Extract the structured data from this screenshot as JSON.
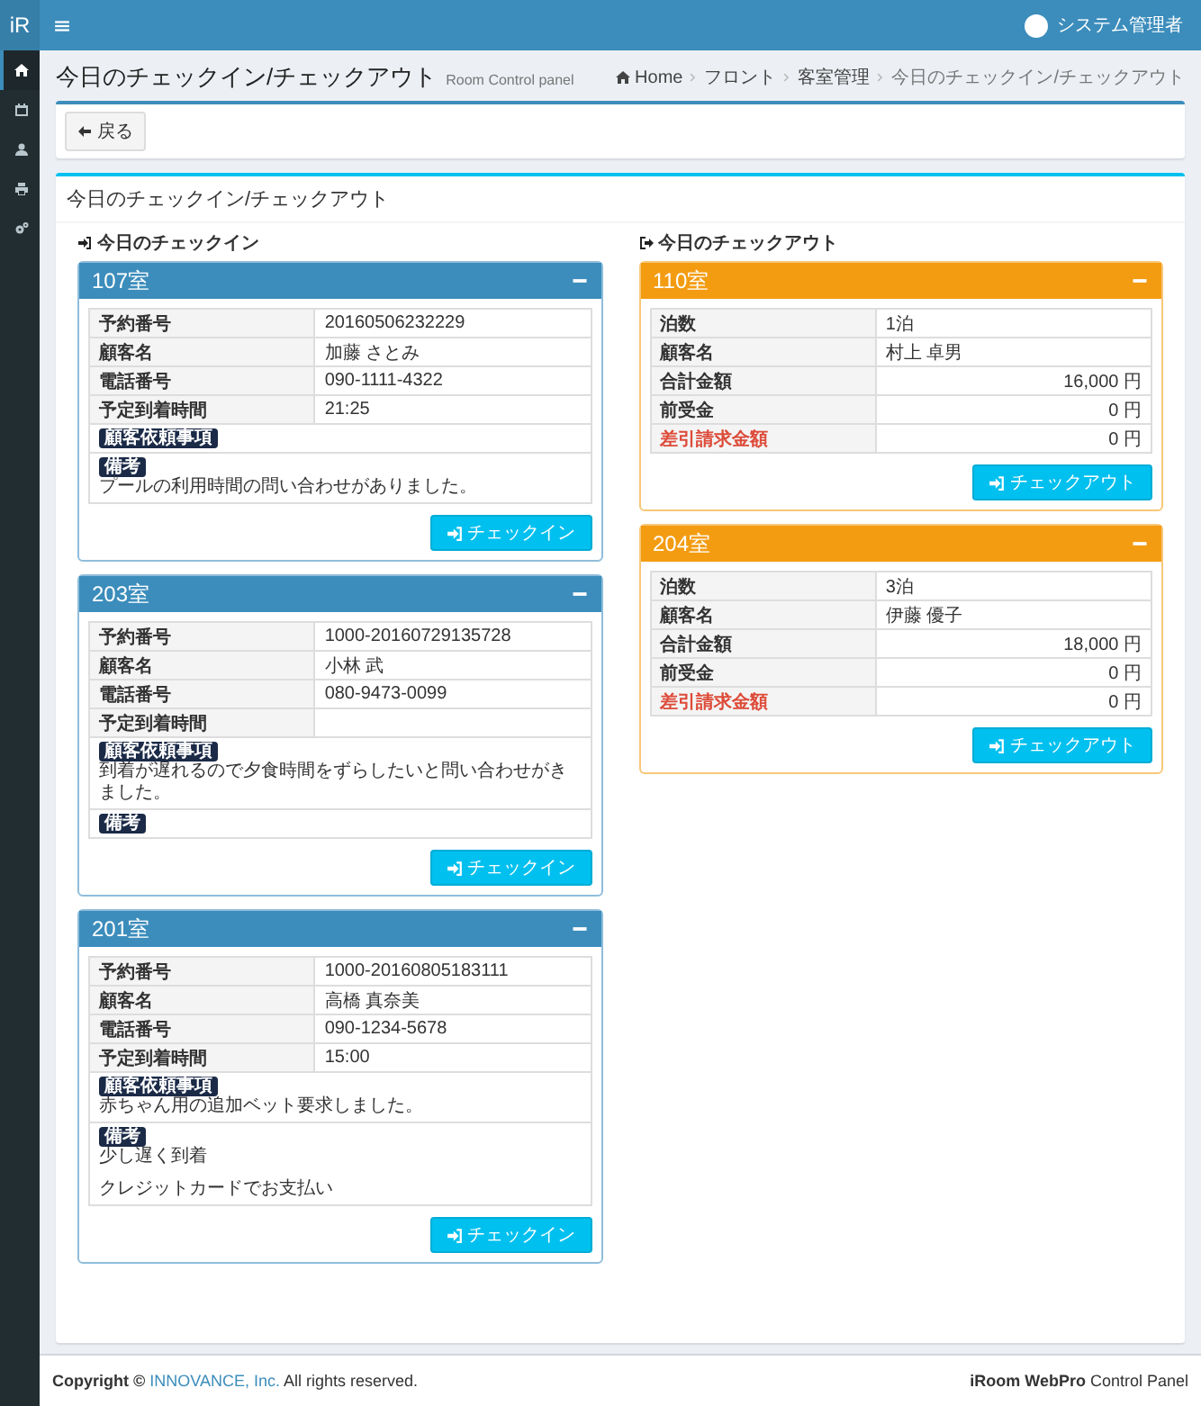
{
  "topbar": {
    "logo": "iR",
    "user": "システム管理者"
  },
  "sidebar": {
    "items": [
      {
        "kind": "home",
        "selected": true
      },
      {
        "kind": "calendar",
        "selected": false
      },
      {
        "kind": "user",
        "selected": false
      },
      {
        "kind": "print",
        "selected": false
      },
      {
        "kind": "cogs",
        "selected": false
      }
    ]
  },
  "page": {
    "title": "今日のチェックイン/チェックアウト",
    "subtitle": "Room Control panel",
    "breadcrumb": [
      "Home",
      "フロント",
      "客室管理",
      "今日のチェックイン/チェックアウト"
    ]
  },
  "back_button": "戻る",
  "box": {
    "title": "今日のチェックイン/チェックアウト",
    "columns": [
      {
        "kind": "checkin",
        "heading": "今日のチェックイン",
        "rooms": [
          {
            "room": "107室",
            "rows": [
              {
                "label": "予約番号",
                "value": "20160506232229",
                "kind": "text"
              },
              {
                "label": "顧客名",
                "value": "加藤 さとみ",
                "kind": "text"
              },
              {
                "label": "電話番号",
                "value": "090-1111-4322",
                "kind": "text"
              },
              {
                "label": "予定到着時間",
                "value": "21:25",
                "kind": "text"
              }
            ],
            "request_label": "顧客依頼事項",
            "notes_label": "備考",
            "notes": [
              "プールの利用時間の問い合わせがありました。"
            ],
            "button": "チェックイン"
          },
          {
            "room": "203室",
            "rows": [
              {
                "label": "予約番号",
                "value": "1000-20160729135728",
                "kind": "text"
              },
              {
                "label": "顧客名",
                "value": "小林 武",
                "kind": "text"
              },
              {
                "label": "電話番号",
                "value": "080-9473-0099",
                "kind": "text"
              },
              {
                "label": "予定到着時間",
                "kind": "text"
              }
            ],
            "request_label": "顧客依頼事項",
            "request": "到着が遅れるので夕食時間をずらしたいと問い合わせがきました。",
            "notes_label": "備考",
            "button": "チェックイン"
          },
          {
            "room": "201室",
            "rows": [
              {
                "label": "予約番号",
                "value": "1000-20160805183111",
                "kind": "text"
              },
              {
                "label": "顧客名",
                "value": "高橋 真奈美",
                "kind": "text"
              },
              {
                "label": "電話番号",
                "value": "090-1234-5678",
                "kind": "text"
              },
              {
                "label": "予定到着時間",
                "value": "15:00",
                "kind": "text"
              }
            ],
            "request_label": "顧客依頼事項",
            "request": "赤ちゃん用の追加ベット要求しました。",
            "notes_label": "備考",
            "notes": [
              "少し遅く到着",
              "クレジットカードでお支払い"
            ],
            "button": "チェックイン"
          }
        ]
      },
      {
        "kind": "checkout",
        "heading": "今日のチェックアウト",
        "rooms": [
          {
            "room": "110室",
            "rows": [
              {
                "label": "泊数",
                "value": "1泊",
                "kind": "text"
              },
              {
                "label": "顧客名",
                "value": "村上 卓男",
                "kind": "text"
              },
              {
                "label": "合計金額",
                "value": "16,000 円",
                "kind": "amount"
              },
              {
                "label": "前受金",
                "value": "0 円",
                "kind": "amount"
              },
              {
                "label": "差引請求金額",
                "value": "0 円",
                "kind": "due"
              }
            ],
            "button": "チェックアウト"
          },
          {
            "room": "204室",
            "rows": [
              {
                "label": "泊数",
                "value": "3泊",
                "kind": "text"
              },
              {
                "label": "顧客名",
                "value": "伊藤 優子",
                "kind": "text"
              },
              {
                "label": "合計金額",
                "value": "18,000 円",
                "kind": "amount"
              },
              {
                "label": "前受金",
                "value": "0 円",
                "kind": "amount"
              },
              {
                "label": "差引請求金額",
                "value": "0 円",
                "kind": "due"
              }
            ],
            "button": "チェックアウト"
          }
        ]
      }
    ]
  },
  "footer": {
    "copyright": "Copyright ©",
    "company": "INNOVANCE, Inc.",
    "rights": "All rights reserved.",
    "product": "**iRoom WebPro** Control Panel"
  }
}
